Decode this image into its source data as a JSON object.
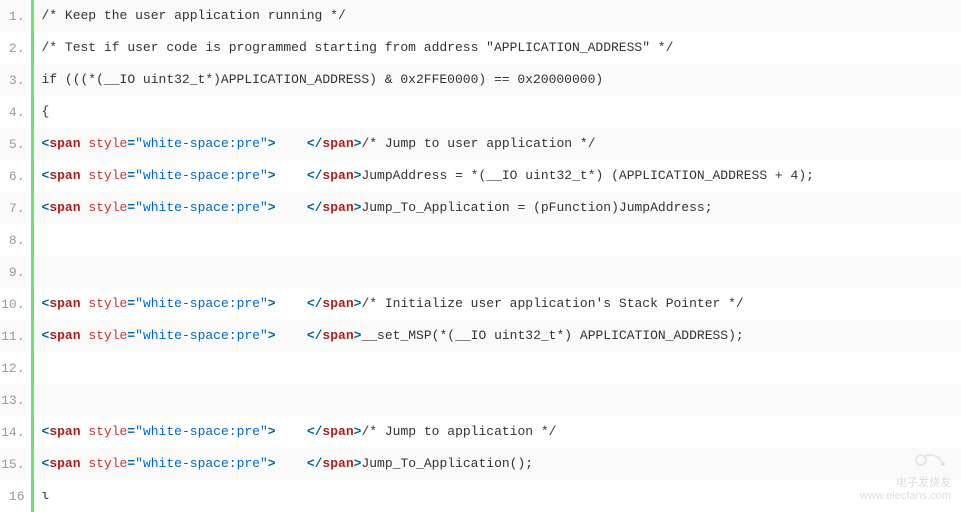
{
  "lines": [
    {
      "n": "1.",
      "plain": "/* Keep the user application running */"
    },
    {
      "n": "2.",
      "plain": "/* Test if user code is programmed starting from address \"APPLICATION_ADDRESS\" */"
    },
    {
      "n": "3.",
      "plain": "if (((*(__IO uint32_t*)APPLICATION_ADDRESS) & 0x2FFE0000) == 0x20000000)"
    },
    {
      "n": "4.",
      "plain": "{"
    },
    {
      "n": "5.",
      "span": true,
      "after": "/* Jump to user application */"
    },
    {
      "n": "6.",
      "span": true,
      "after": "JumpAddress = *(__IO uint32_t*) (APPLICATION_ADDRESS + 4);"
    },
    {
      "n": "7.",
      "span": true,
      "after": "Jump_To_Application = (pFunction)JumpAddress;"
    },
    {
      "n": "8.",
      "plain": " "
    },
    {
      "n": "9.",
      "plain": " "
    },
    {
      "n": "10.",
      "span": true,
      "after": "/* Initialize user application's Stack Pointer */"
    },
    {
      "n": "11.",
      "span": true,
      "after": "__set_MSP(*(__IO uint32_t*) APPLICATION_ADDRESS);"
    },
    {
      "n": "12.",
      "plain": " "
    },
    {
      "n": "13.",
      "plain": " "
    },
    {
      "n": "14.",
      "span": true,
      "after": "/* Jump to application */"
    },
    {
      "n": "15.",
      "span": true,
      "after": "Jump_To_Application();"
    },
    {
      "n": "16",
      "plain": "ι",
      "partial": true
    }
  ],
  "span_markup": {
    "open_lt": "<",
    "open_elem": "span",
    "attr_name": " style",
    "eq": "=",
    "attr_val": "\"white-space:pre\"",
    "open_gt": ">",
    "inner_ws": "    ",
    "close_lt": "</",
    "close_elem": "span",
    "close_gt": ">"
  },
  "watermark": {
    "brand": "电子发烧友",
    "url": "www.elecfans.com"
  }
}
